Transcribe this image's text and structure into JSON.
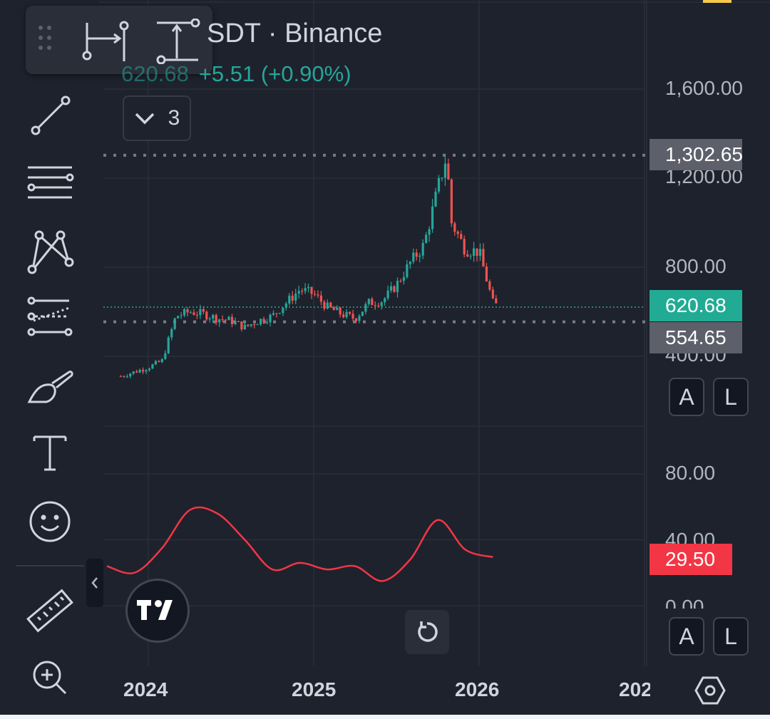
{
  "header": {
    "symbol_title": "SDT · Binance",
    "last_price_partial": "620.68",
    "change": "+5.51 (+0.90%)",
    "indicators_count": "3"
  },
  "price_axis": {
    "labels": [
      "1,600.00",
      "1,200.00",
      "800.00",
      "400.00"
    ],
    "high_tag": "1,302.65",
    "last_tag": "620.68",
    "low_tag": "554.65",
    "scale_buttons": [
      "A",
      "L"
    ]
  },
  "oscillator_axis": {
    "labels": [
      "80.00",
      "40.00",
      "0.00"
    ],
    "value_tag": "29.50",
    "scale_buttons": [
      "A",
      "L"
    ]
  },
  "time_axis": {
    "labels": [
      "2024",
      "2025",
      "2026",
      "202"
    ]
  },
  "toolbar": {
    "icons": [
      "trend-line-icon",
      "horizontal-lines-icon",
      "pattern-icon",
      "fib-icon",
      "brush-icon",
      "text-icon",
      "emoji-icon",
      "ruler-icon",
      "zoom-in-icon"
    ]
  },
  "colors": {
    "up": "#26a69a",
    "down": "#ef5350",
    "background": "#1e222d",
    "oscillator": "#f23645",
    "last_price": "#22ab94"
  },
  "chart_data": {
    "type": "candlestick",
    "ylim": [
      0,
      1700
    ],
    "grid": true,
    "reference_lines": {
      "high": 1302.65,
      "last": 620.68,
      "low": 554.65
    },
    "x_range": [
      "2023-10",
      "2026-03"
    ],
    "price_series": [
      [
        "2023-11",
        310
      ],
      [
        "2023-12",
        330
      ],
      [
        "2024-01",
        350
      ],
      [
        "2024-02",
        380
      ],
      [
        "2024-03",
        580
      ],
      [
        "2024-04",
        600
      ],
      [
        "2024-05",
        590
      ],
      [
        "2024-06",
        570
      ],
      [
        "2024-07",
        560
      ],
      [
        "2024-08",
        530
      ],
      [
        "2024-09",
        560
      ],
      [
        "2024-10",
        580
      ],
      [
        "2024-11",
        640
      ],
      [
        "2024-12",
        700
      ],
      [
        "2025-01",
        680
      ],
      [
        "2025-02",
        620
      ],
      [
        "2025-03",
        590
      ],
      [
        "2025-04",
        570
      ],
      [
        "2025-05",
        640
      ],
      [
        "2025-06",
        650
      ],
      [
        "2025-07",
        720
      ],
      [
        "2025-08",
        820
      ],
      [
        "2025-09",
        900
      ],
      [
        "2025-10",
        1150
      ],
      [
        "2025-10-20",
        1300
      ],
      [
        "2025-11",
        1000
      ],
      [
        "2025-12",
        880
      ],
      [
        "2026-01",
        870
      ],
      [
        "2026-02",
        640
      ],
      [
        "2026-02-15",
        620
      ]
    ],
    "oscillator": {
      "ylim": [
        0,
        100
      ],
      "series": [
        [
          "2023-10",
          24
        ],
        [
          "2023-12",
          20
        ],
        [
          "2024-02",
          35
        ],
        [
          "2024-04",
          58
        ],
        [
          "2024-06",
          56
        ],
        [
          "2024-08",
          40
        ],
        [
          "2024-10",
          22
        ],
        [
          "2024-12",
          26
        ],
        [
          "2025-02",
          22
        ],
        [
          "2025-04",
          24
        ],
        [
          "2025-06",
          15
        ],
        [
          "2025-08",
          28
        ],
        [
          "2025-10",
          52
        ],
        [
          "2025-12",
          34
        ],
        [
          "2026-02",
          29.5
        ]
      ]
    }
  }
}
